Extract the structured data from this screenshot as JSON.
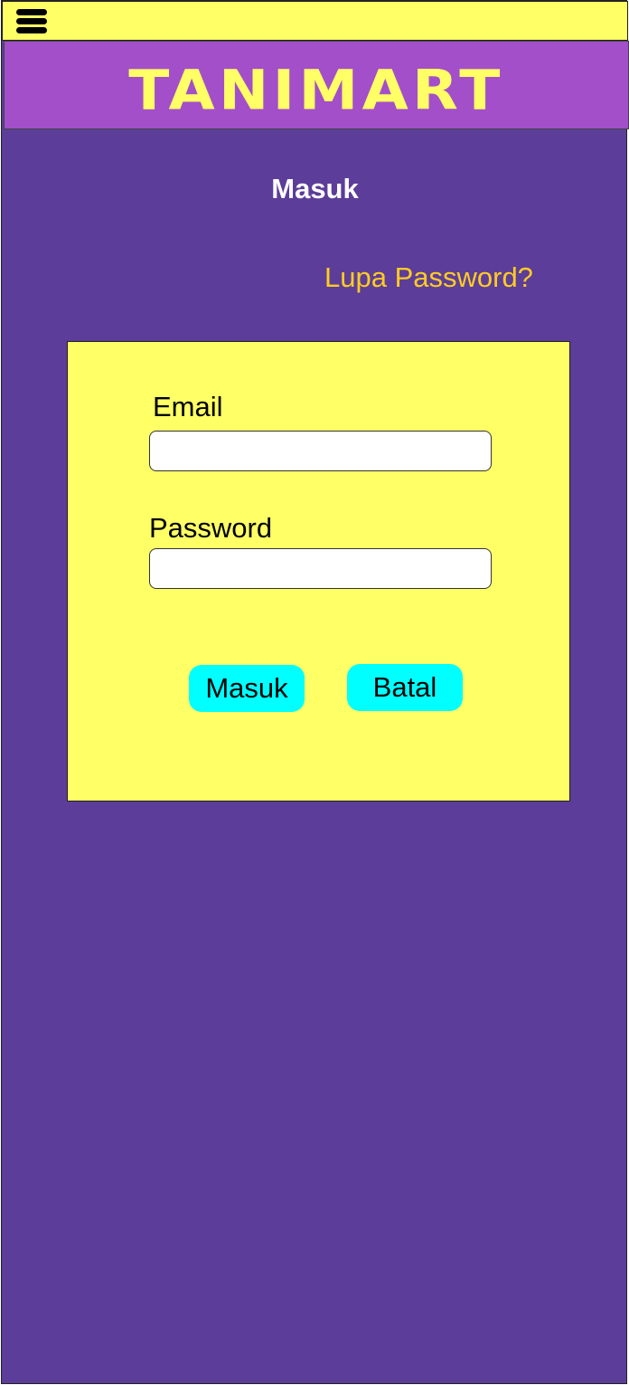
{
  "app": {
    "brand": "TANIMART",
    "brand_color": "#ffff66",
    "header_color": "#a34fc9",
    "background_color": "#5c3d99"
  },
  "topbar": {
    "menu_icon": "hamburger-menu-icon"
  },
  "page": {
    "title": "Masuk",
    "forgot_password_link": "Lupa Password?"
  },
  "form": {
    "email_label": "Email",
    "email_value": "",
    "password_label": "Password",
    "password_value": "",
    "submit_label": "Masuk",
    "cancel_label": "Batal",
    "button_color": "#00ffff"
  }
}
